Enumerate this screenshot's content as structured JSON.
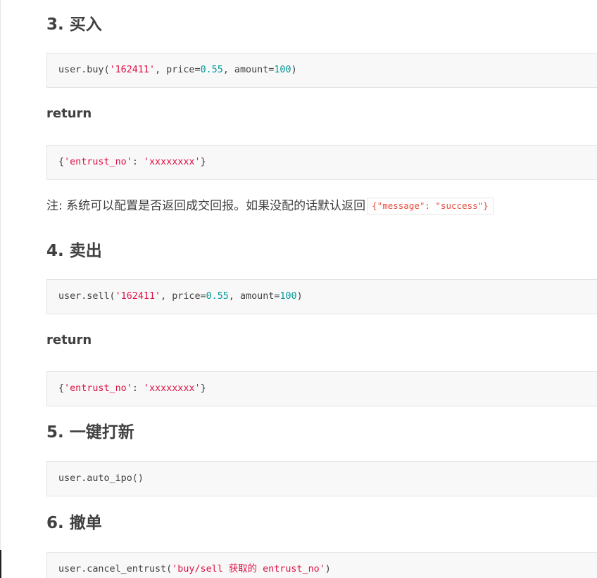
{
  "sections": [
    {
      "heading": "3. 买入",
      "code": {
        "prefix": "user.buy(",
        "arg1": "'162411'",
        "mid1": ", price=",
        "price": "0.55",
        "mid2": ", amount=",
        "amount": "100",
        "suffix": ")"
      },
      "return_label": "return",
      "return_code": {
        "open": "{",
        "key": "'entrust_no'",
        "colon": ": ",
        "value": "'xxxxxxxx'",
        "close": "}"
      },
      "note": {
        "text": "注: 系统可以配置是否返回成交回报。如果没配的话默认返回",
        "code": "{\"message\": \"success\"}"
      }
    },
    {
      "heading": "4. 卖出",
      "code": {
        "prefix": "user.sell(",
        "arg1": "'162411'",
        "mid1": ", price=",
        "price": "0.55",
        "mid2": ", amount=",
        "amount": "100",
        "suffix": ")"
      },
      "return_label": "return",
      "return_code": {
        "open": "{",
        "key": "'entrust_no'",
        "colon": ": ",
        "value": "'xxxxxxxx'",
        "close": "}"
      }
    },
    {
      "heading": "5. 一键打新",
      "code": {
        "text": "user.auto_ipo()"
      }
    },
    {
      "heading": "6. 撤单",
      "code": {
        "prefix": "user.cancel_entrust(",
        "arg1": "'buy/sell 获取的 entrust_no'",
        "suffix": ")"
      }
    }
  ]
}
